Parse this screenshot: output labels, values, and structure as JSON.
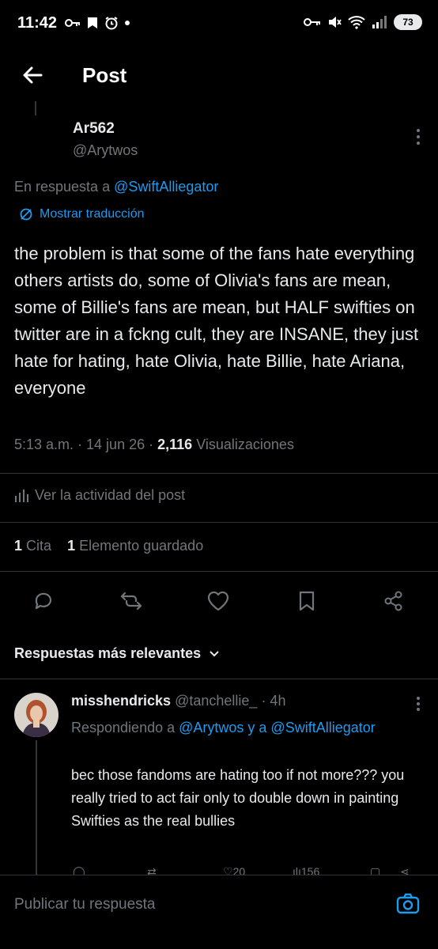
{
  "status_bar": {
    "time": "11:42",
    "battery": "73"
  },
  "header": {
    "title": "Post"
  },
  "post": {
    "author_name": "Ar562",
    "author_handle": "@Arytwos",
    "reply_prefix": "En respuesta a",
    "reply_to": "@SwiftAlliegator",
    "translate": "Mostrar traducción",
    "text": "the problem is that some of the fans hate everything others artists do, some of Olivia's fans are mean, some of Billie's fans are mean, but HALF swifties on twitter are in a fckng cult, they are INSANE, they just hate for hating, hate Olivia, hate Billie, hate Ariana, everyone",
    "timestamp": "5:13 a.m. · 14 jun 26 ·",
    "views_count": "2,116",
    "views_label": "Visualizaciones",
    "activity": "Ver la actividad del post",
    "quotes_count": "1",
    "quotes_label": "Cita",
    "bookmarks_count": "1",
    "bookmarks_label": "Elemento guardado"
  },
  "sort": {
    "label": "Respuestas más relevantes"
  },
  "reply": {
    "name": "misshendricks",
    "handle": "@tanchellie_",
    "time": "· 4h",
    "ctx_prefix": "Respondiendo a",
    "ctx_users": "@Arytwos y a @SwiftAlliegator",
    "text": "bec those fandoms are hating too if not more??? you really tried to act fair only to double down in painting Swifties as the real bullies",
    "likes": "20",
    "views": "156"
  },
  "composer": {
    "placeholder": "Publicar tu respuesta"
  }
}
